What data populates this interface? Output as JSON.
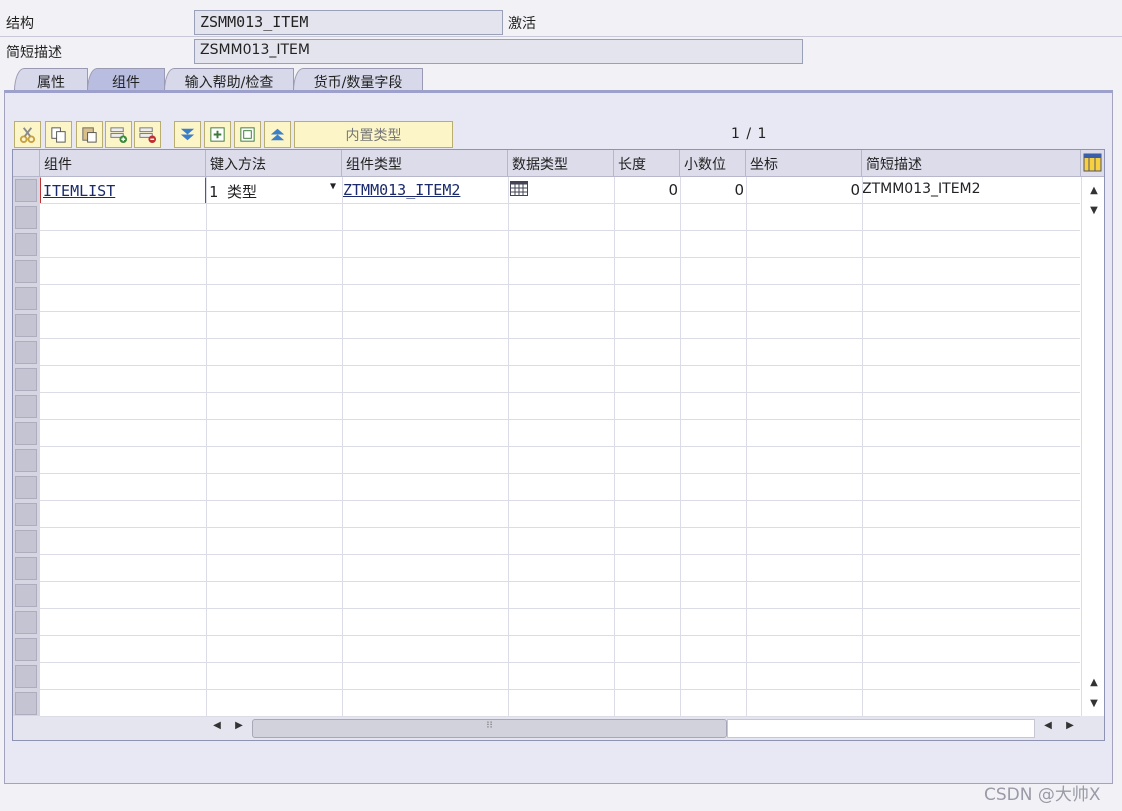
{
  "header": {
    "structure_label": "结构",
    "structure_value": "ZSMM013_ITEM",
    "status": "激活",
    "short_desc_label": "简短描述",
    "short_desc_value": "ZSMM013_ITEM"
  },
  "tabs": [
    "属性",
    "组件",
    "输入帮助/检查",
    "货币/数量字段"
  ],
  "active_tab": "组件",
  "toolbar": {
    "builtin_type_label": "内置类型"
  },
  "pager": {
    "text": "1 / 1"
  },
  "table": {
    "columns": [
      "组件",
      "键入方法",
      "组件类型",
      "数据类型",
      "长度",
      "小数位",
      "坐标",
      "简短描述"
    ],
    "rows": [
      {
        "component": "ITEMLIST",
        "typing_method": "1 类型",
        "component_type": "ZTMM013_ITEM2",
        "data_type_icon": "table-type-icon",
        "length": "0",
        "decimals": "0",
        "coordinate": "0",
        "short_desc": "ZTMM013_ITEM2"
      }
    ]
  },
  "watermark": "CSDN @大帅X",
  "colors": {
    "toolbar_bg": "#fbf5c8",
    "active_tab": "#b9bde0",
    "panel_bg": "#e8e8f4"
  }
}
